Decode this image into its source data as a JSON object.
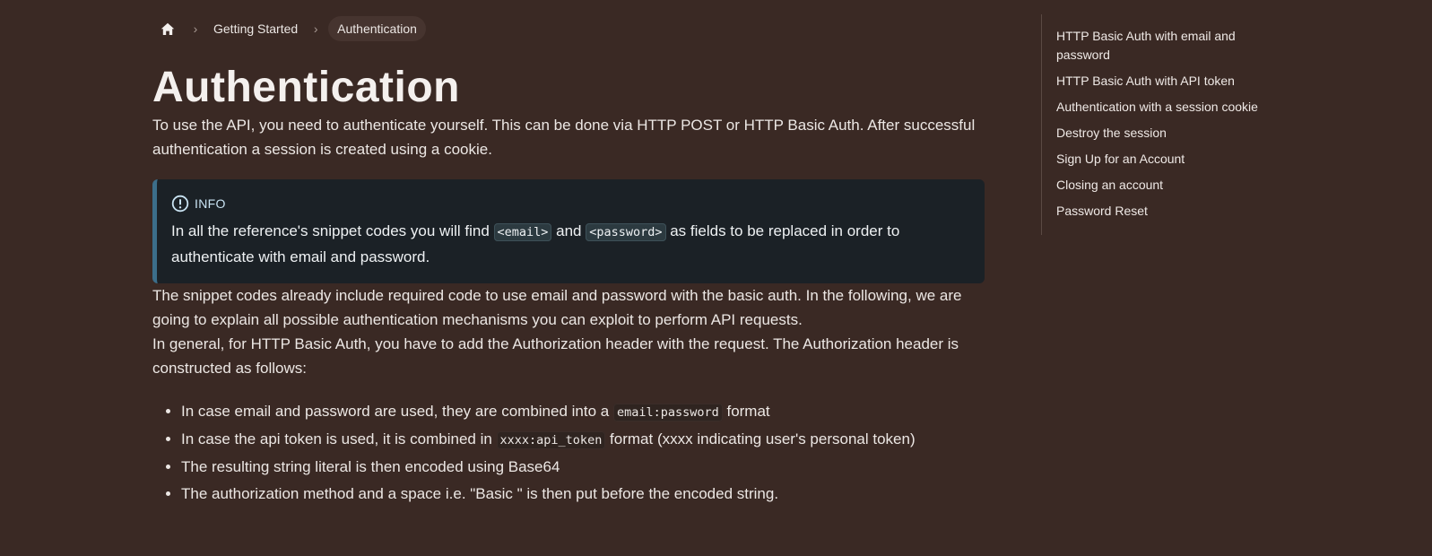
{
  "breadcrumb": {
    "home_icon": "home-icon",
    "separator": "›",
    "items": [
      "Getting Started",
      "Authentication"
    ]
  },
  "page": {
    "title": "Authentication",
    "intro": "To use the API, you need to authenticate yourself. This can be done via HTTP POST or HTTP Basic Auth. After successful authentication a session is created using a cookie."
  },
  "info": {
    "icon": "info-icon",
    "label": "INFO",
    "text_before": "In all the reference's snippet codes you will find ",
    "code_email": "<email>",
    "text_and": " and ",
    "code_password": "<password>",
    "text_after": " as fields to be replaced in order to authenticate with email and password."
  },
  "paragraphs": {
    "p2": "The snippet codes already include required code to use email and password with the basic auth. In the following, we are going to explain all possible authentication mechanisms you can exploit to perform API requests.",
    "p3": "In general, for HTTP Basic Auth, you have to add the Authorization header with the request. The Authorization header is constructed as follows:"
  },
  "bullets": {
    "b1_before": "In case email and password are used, they are combined into a ",
    "b1_code": "email:password",
    "b1_after": " format",
    "b2_before": "In case the api token is used, it is combined in ",
    "b2_code": "xxxx:api_token",
    "b2_after": " format (xxxx indicating user's personal token)",
    "b3": "The resulting string literal is then encoded using Base64",
    "b4": "The authorization method and a space i.e. \"Basic \" is then put before the encoded string."
  },
  "toc": {
    "items": [
      "HTTP Basic Auth with email and password",
      "HTTP Basic Auth with API token",
      "Authentication with a session cookie",
      "Destroy the session",
      "Sign Up for an Account",
      "Closing an account",
      "Password Reset"
    ]
  },
  "colors": {
    "background": "#3a2924",
    "info_bg": "#1b2126",
    "info_accent": "#3c6e8a"
  }
}
